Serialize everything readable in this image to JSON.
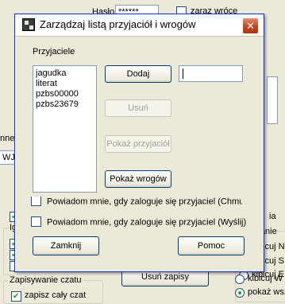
{
  "background": {
    "password_label": "Hasło",
    "password_value": "******",
    "remember_label": "zaraz wróce",
    "partial_label_1": "nne (",
    "partial_input_1": "WJ, ",
    "partial_group_label": "Ig",
    "side_label_a": "ia",
    "side_label_b": "wanie",
    "side_item_n": "kibicuj N",
    "side_item_s": "kibicuj S",
    "side_item_e": "kibicuj E",
    "side_item_w": "kibicuj W",
    "side_item_show": "pokaż wsz",
    "chat_group_label": "Zapisywanie czatu",
    "chat_save_all": "zapisz cały czat",
    "delete_saves_button": "Usuń zapisy"
  },
  "dialog": {
    "title": "Zarządzaj listą przyjaciół i wrogów",
    "friends_label": "Przyjaciele",
    "friends": [
      "jagudka",
      "literat",
      "pzbs00000",
      "pzbs23679"
    ],
    "add_button": "Dodaj",
    "name_input_value": "",
    "remove_button": "Usuń",
    "show_friends_button": "Pokaż przyjaciół",
    "show_enemies_button": "Pokaż wrogów",
    "notify_chime_label": "Powiadom mnie, gdy zaloguje się przyjaciel (Chmurka)",
    "notify_send_label": "Powiadom mnie, gdy zaloguje się przyjaciel (Wyślij)",
    "close_button": "Zamknij",
    "help_button": "Pomoc"
  }
}
